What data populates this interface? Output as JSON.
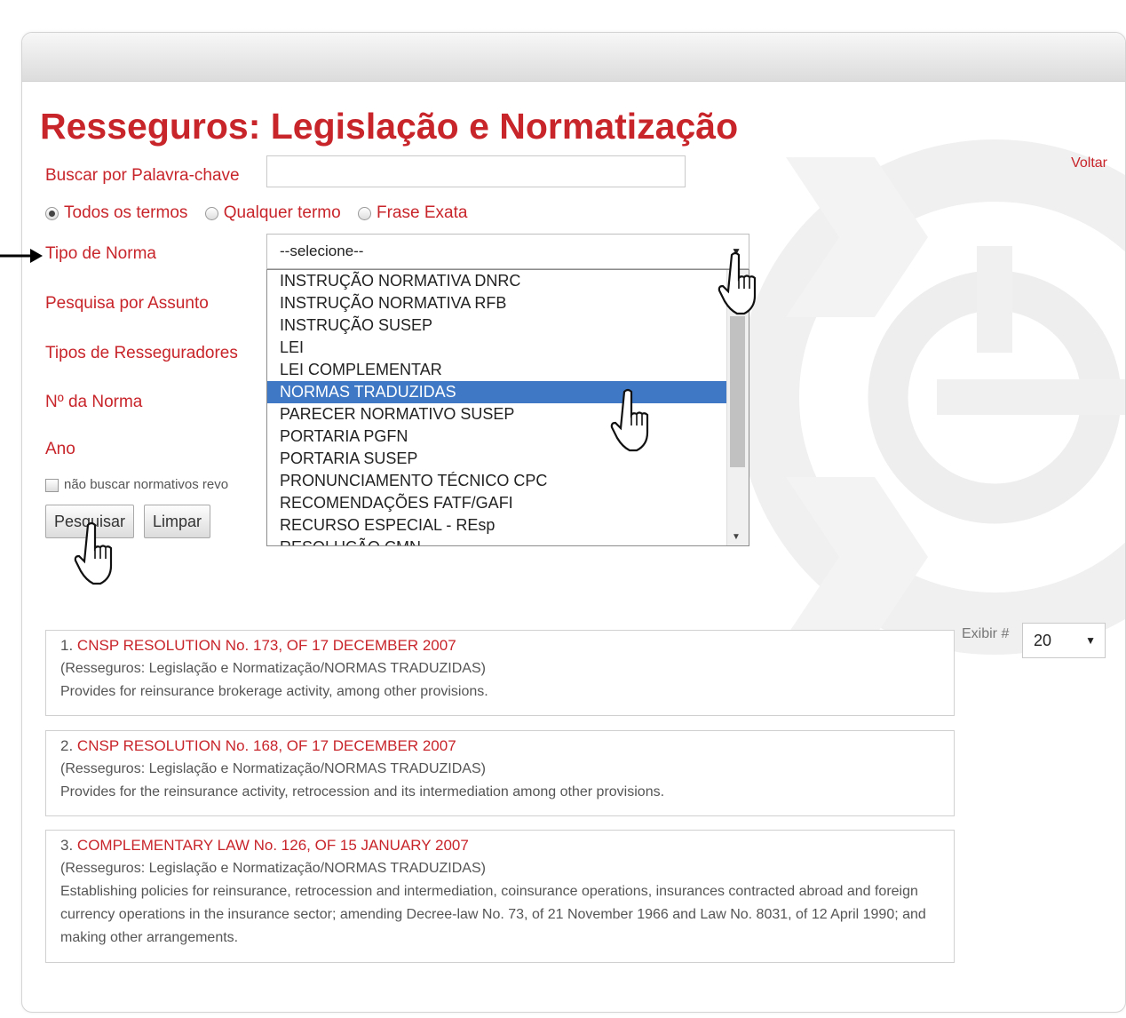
{
  "page": {
    "title": "Resseguros: Legislação e Normatização",
    "back_link": "Voltar"
  },
  "form": {
    "keyword_label": "Buscar por Palavra-chave",
    "keyword_value": "",
    "search_mode": {
      "options": [
        "Todos os termos",
        "Qualquer termo",
        "Frase Exata"
      ],
      "selected": "Todos os termos"
    },
    "norma_type_label": "Tipo de Norma",
    "norma_type_selected": "--selecione--",
    "subject_label": "Pesquisa por Assunto",
    "reinsurer_types_label": "Tipos de Resseguradores",
    "norma_number_label": "Nº da Norma",
    "year_label": "Ano",
    "exclude_revoked_label": "não buscar normativos revo",
    "search_button": "Pesquisar",
    "clear_button": "Limpar"
  },
  "dropdown": {
    "items": [
      "INSTRUÇÃO NORMATIVA DNRC",
      "INSTRUÇÃO NORMATIVA RFB",
      "INSTRUÇÃO SUSEP",
      "LEI",
      "LEI COMPLEMENTAR",
      "NORMAS TRADUZIDAS",
      "PARECER NORMATIVO SUSEP",
      "PORTARIA PGFN",
      "PORTARIA SUSEP",
      "PRONUNCIAMENTO TÉCNICO CPC",
      "RECOMENDAÇÕES FATF/GAFI",
      "RECURSO ESPECIAL - REsp",
      "RESOLUÇÃO CMN"
    ],
    "highlighted": "NORMAS TRADUZIDAS"
  },
  "results": [
    {
      "number": "1.",
      "title": "CNSP RESOLUTION No. 173, OF 17 DECEMBER 2007",
      "category": "(Resseguros: Legislação e Normatização/NORMAS TRADUZIDAS)",
      "summary": "Provides for reinsurance brokerage activity, among other provisions."
    },
    {
      "number": "2.",
      "title": "CNSP RESOLUTION No. 168, OF 17 DECEMBER 2007",
      "category": "(Resseguros: Legislação e Normatização/NORMAS TRADUZIDAS)",
      "summary": "Provides for the reinsurance activity, retrocession and its intermediation among other provisions."
    },
    {
      "number": "3.",
      "title": "COMPLEMENTARY LAW No. 126, OF 15 JANUARY 2007",
      "category": "(Resseguros: Legislação e Normatização/NORMAS TRADUZIDAS)",
      "summary": "Establishing policies for reinsurance, retrocession and intermediation, coinsurance operations, insurances contracted abroad and foreign currency operations in the insurance sector; amending Decree-law No. 73, of 21 November 1966 and Law No. 8031, of 12 April 1990; and making other arrangements."
    }
  ],
  "pagination": {
    "show_label": "Exibir #",
    "show_value": "20"
  },
  "colors": {
    "accent": "#c8252b",
    "highlight": "#3f78c4"
  },
  "icons": {
    "dropdown_caret": "▼",
    "pointer": "hand-pointer-icon",
    "annotation_arrow": "arrow-right-icon"
  }
}
